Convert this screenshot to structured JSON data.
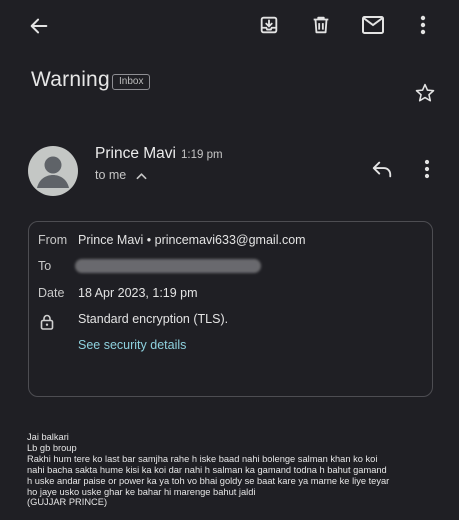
{
  "toolbar": {
    "back": "back-arrow-icon",
    "archive": "archive-icon",
    "delete": "trash-icon",
    "mark_unread": "mail-icon",
    "more": "more-vert-icon"
  },
  "subject": {
    "title": "Warning",
    "label_chip": "Inbox"
  },
  "sender": {
    "name": "Prince Mavi",
    "time": "1:19 pm",
    "recipient_summary": "to me"
  },
  "details": {
    "from_label": "From",
    "from_value": "Prince Mavi • princemavi633@gmail.com",
    "to_label": "To",
    "date_label": "Date",
    "date_value": "18 Apr 2023, 1:19 pm",
    "encryption_value": "Standard encryption (TLS).",
    "security_link": "See security details"
  },
  "message": {
    "lines": [
      "Jai balkari",
      "Lb gb broup",
      "Rakhi hum tere ko last bar samjha rahe h iske baad nahi bolenge salman khan ko koi",
      "nahi bacha sakta hume kisi ka koi dar nahi h salman ka gamand todna h bahut gamand",
      "h uske andar paise or power ka ya toh vo bhai goldy se baat kare ya marne ke liye teyar",
      "ho jaye usko uske ghar ke bahar hi marenge bahut jaldi",
      "(GUJJAR PRINCE)"
    ]
  },
  "colors": {
    "background": "#1f1f24",
    "link": "#8ed1de",
    "card_border": "#4d4d52",
    "avatar": "#c4c7c5"
  }
}
